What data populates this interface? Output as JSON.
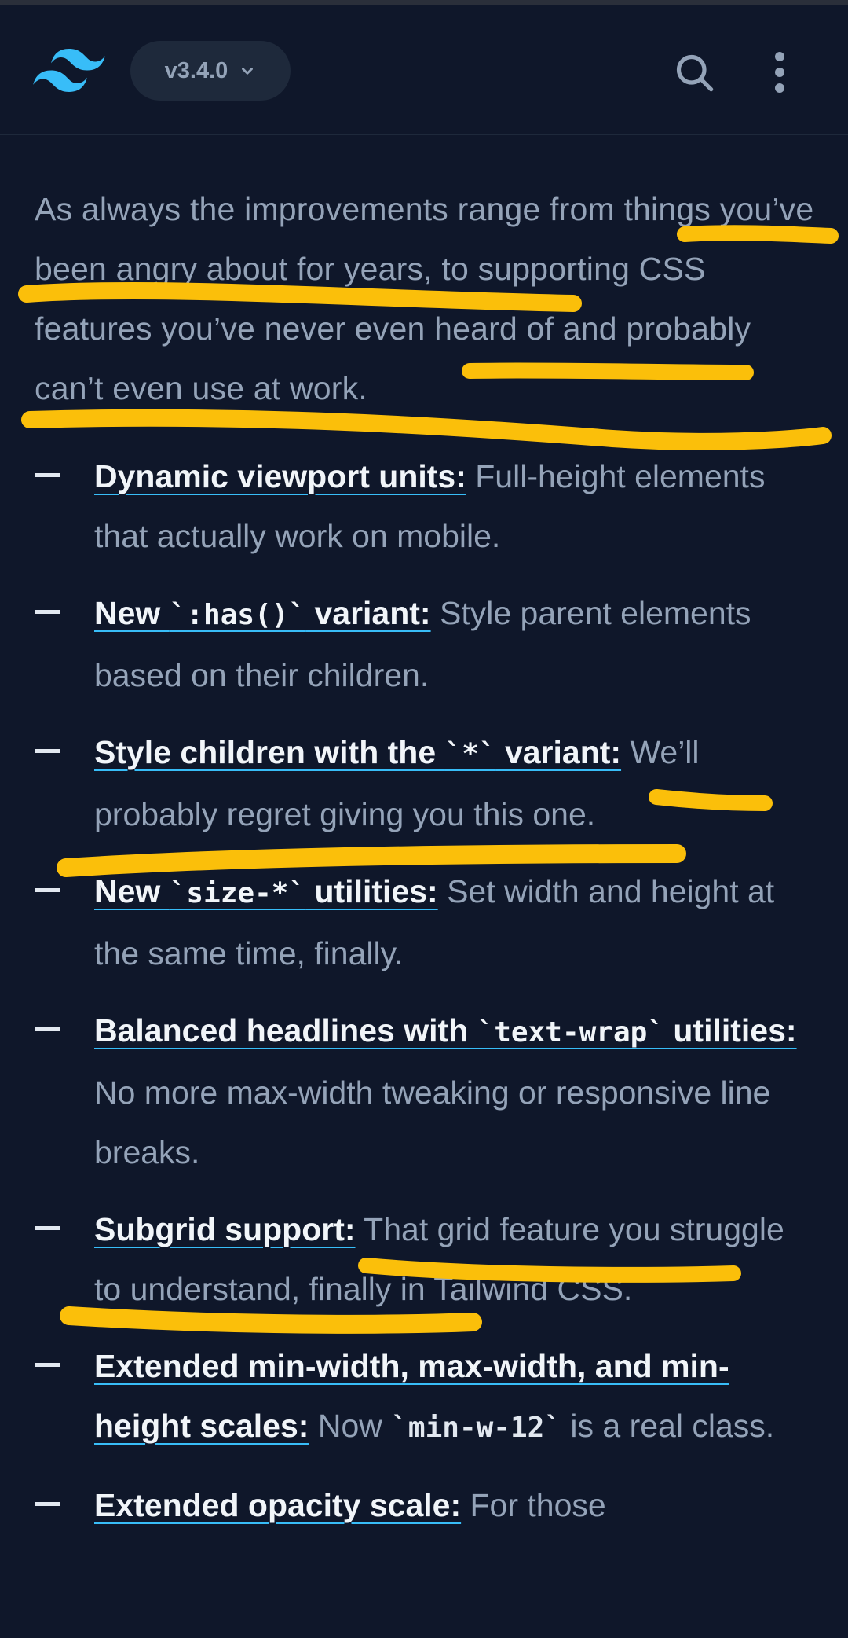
{
  "header": {
    "logo_icon": "tailwind-logo-icon",
    "version": "v3.4.0",
    "search_icon": "search-icon",
    "menu_icon": "more-vertical-icon"
  },
  "colors": {
    "background": "#0f172a",
    "accent": "#38bdf8",
    "highlight": "#fbbf0a"
  },
  "intro": "As always the improvements range from things you’ve been angry about for years, to supporting CSS features you’ve never even heard of and probably can’t even use at work.",
  "features": [
    {
      "title": [
        "Dynamic viewport units:"
      ],
      "desc": [
        " Full-height elements that actually work on mobile."
      ]
    },
    {
      "title": [
        "New ",
        "`:has()`",
        " variant:"
      ],
      "desc": [
        " Style parent elements based on their children."
      ]
    },
    {
      "title": [
        "Style children with the ",
        "`*`",
        " variant:"
      ],
      "desc": [
        " We’ll probably regret giving you this one."
      ]
    },
    {
      "title": [
        "New ",
        "`size-*`",
        " utilities:"
      ],
      "desc": [
        " Set width and height at the same time, finally."
      ]
    },
    {
      "title": [
        "Balanced headlines with ",
        "`text-wrap`",
        " utilities:"
      ],
      "desc": [
        " No more max-width tweaking or responsive line breaks."
      ]
    },
    {
      "title": [
        "Subgrid support:"
      ],
      "desc": [
        " That grid feature you struggle to understand, finally in Tailwind CSS."
      ]
    },
    {
      "title": [
        "Extended min-width, max-width, and min-height scales:"
      ],
      "desc": [
        " Now ",
        "`min-w-12`",
        " is a real class."
      ]
    },
    {
      "title": [
        "Extended opacity scale:"
      ],
      "desc": [
        " For those"
      ]
    }
  ]
}
